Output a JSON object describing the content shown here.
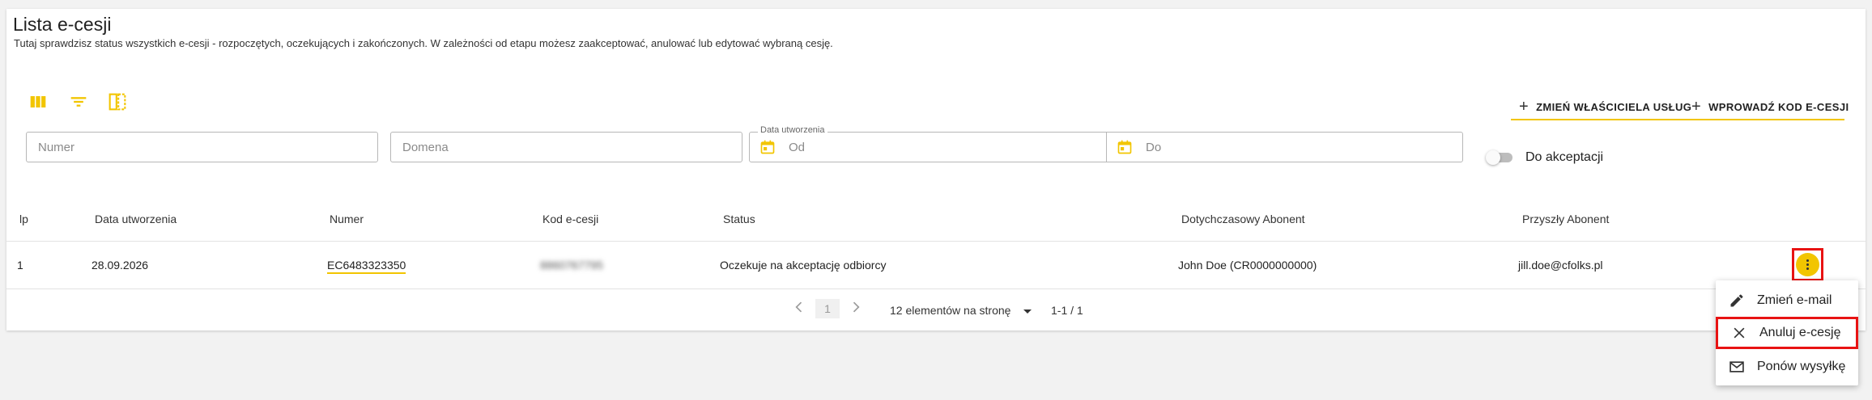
{
  "header": {
    "title": "Lista e-cesji",
    "subtitle": "Tutaj sprawdzisz status wszystkich e-cesji - rozpoczętych, oczekujących i zakończonych. W zależności od etapu możesz zaakceptować, anulować lub edytować wybraną cesję."
  },
  "toolbar": {
    "icons": [
      "columns-icon",
      "filter-icon",
      "density-icon"
    ],
    "change_owner_label": "ZMIEŃ WŁAŚCICIELA USŁUG",
    "enter_code_label": "WPROWADŹ KOD E-CESJI",
    "accent_color": "#f2c500"
  },
  "filters": {
    "number_placeholder": "Numer",
    "domain_placeholder": "Domena",
    "date_legend": "Data utworzenia",
    "date_from_placeholder": "Od",
    "date_to_placeholder": "Do",
    "toggle_label": "Do akceptacji",
    "toggle_checked": false
  },
  "table": {
    "columns": [
      "lp",
      "Data utworzenia",
      "Numer",
      "Kod e-cesji",
      "Status",
      "Dotychczasowy Abonent",
      "Przyszły Abonent"
    ],
    "rows": [
      {
        "lp": "1",
        "date": "28.09.2026",
        "number": "EC6483323350",
        "code": "8860767795",
        "status": "Oczekuje na akceptację odbiorcy",
        "current_subscriber": "John Doe (CR0000000000)",
        "future_subscriber": "jill.doe@cfolks.pl"
      }
    ]
  },
  "pagination": {
    "page": "1",
    "per_page_label": "12 elementów na stronę",
    "range": "1-1 / 1"
  },
  "row_menu": {
    "items": [
      {
        "label": "Zmień e-mail",
        "icon": "pencil-icon"
      },
      {
        "label": "Anuluj e-cesję",
        "icon": "close-icon"
      },
      {
        "label": "Ponów wysyłkę",
        "icon": "mail-icon"
      }
    ],
    "highlight_color": "#e81313"
  }
}
